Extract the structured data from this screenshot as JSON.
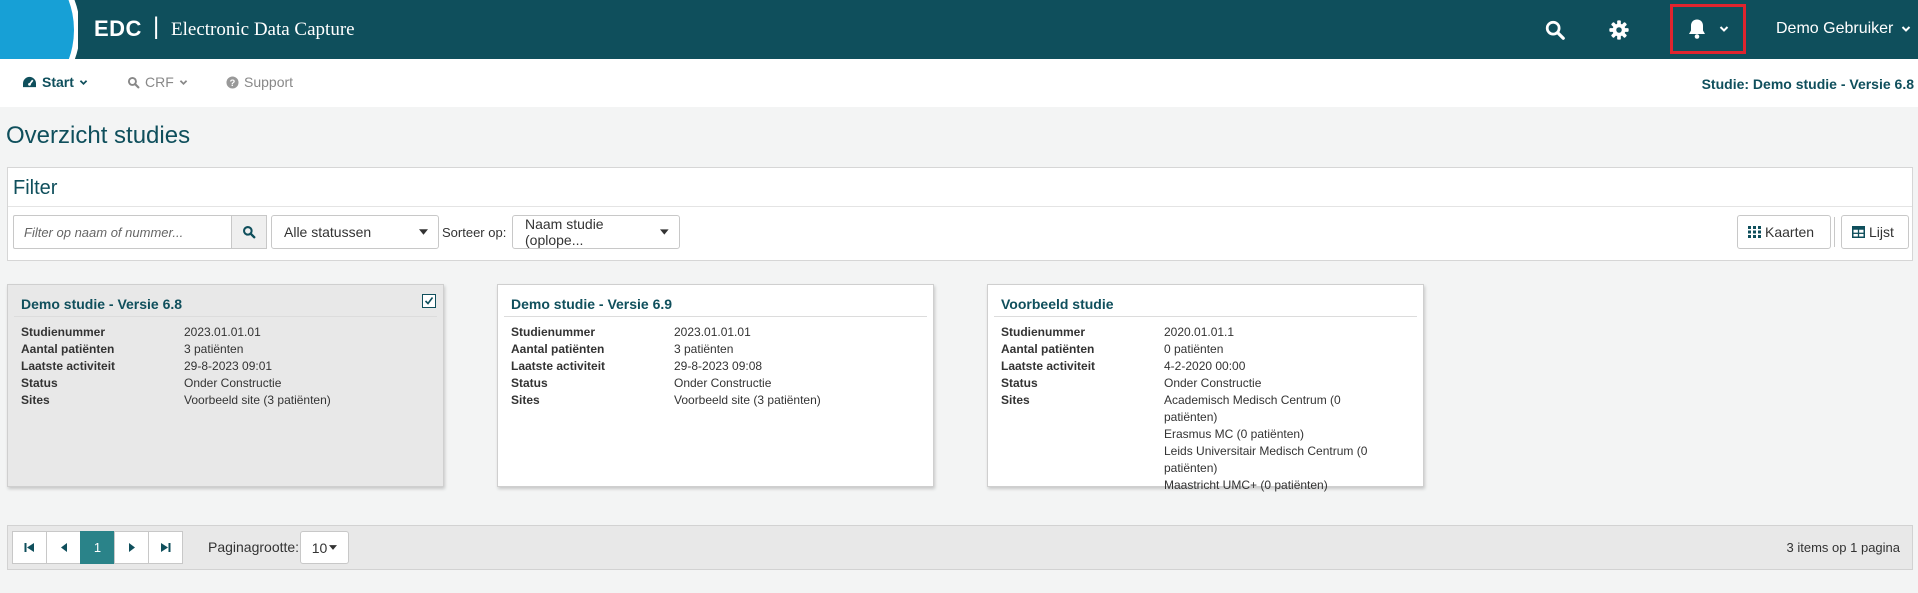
{
  "header": {
    "brand": "EDC",
    "separator": "|",
    "subtitle": "Electronic Data Capture",
    "user_name": "Demo Gebruiker",
    "icons": [
      "search-icon",
      "gear-icon",
      "bell-icon",
      "chevron-down-icon"
    ],
    "colors": {
      "bar": "#0f4f5c",
      "logo_arc": "#17a0d6",
      "highlight_box": "#e0242e"
    }
  },
  "nav": {
    "start": "Start",
    "crf": "CRF",
    "support": "Support",
    "study_label": "Studie: Demo studie - Versie 6.8"
  },
  "page": {
    "title": "Overzicht studies"
  },
  "filter": {
    "title": "Filter",
    "search_placeholder": "Filter op naam of nummer...",
    "status_value": "Alle statussen",
    "sort_label": "Sorteer op:",
    "sort_value": "Naam studie (oplope...",
    "view_cards": "Kaarten",
    "view_list": "Lijst"
  },
  "labels": {
    "studienummer": "Studienummer",
    "aantal": "Aantal patiënten",
    "activiteit": "Laatste activiteit",
    "status": "Status",
    "sites": "Sites"
  },
  "cards": [
    {
      "title": "Demo studie - Versie 6.8",
      "studienummer": "2023.01.01.01",
      "aantal": "3 patiënten",
      "activiteit": "29-8-2023 09:01",
      "status": "Onder Constructie",
      "sites": [
        "Voorbeeld site (3 patiënten)"
      ],
      "selected": true
    },
    {
      "title": "Demo studie - Versie 6.9",
      "studienummer": "2023.01.01.01",
      "aantal": "3 patiënten",
      "activiteit": "29-8-2023 09:08",
      "status": "Onder Constructie",
      "sites": [
        "Voorbeeld site (3 patiënten)"
      ],
      "selected": false
    },
    {
      "title": "Voorbeeld studie",
      "studienummer": "2020.01.01.1",
      "aantal": "0 patiënten",
      "activiteit": "4-2-2020 00:00",
      "status": "Onder Constructie",
      "sites": [
        "Academisch Medisch Centrum (0 patiënten)",
        "Erasmus MC (0 patiënten)",
        "Leids Universitair Medisch Centrum (0 patiënten)",
        "Maastricht UMC+ (0 patiënten)"
      ],
      "selected": false
    }
  ],
  "pager": {
    "current_page": "1",
    "page_size_label": "Paginagrootte:",
    "page_size": "10",
    "info": "3 items op 1 pagina"
  }
}
